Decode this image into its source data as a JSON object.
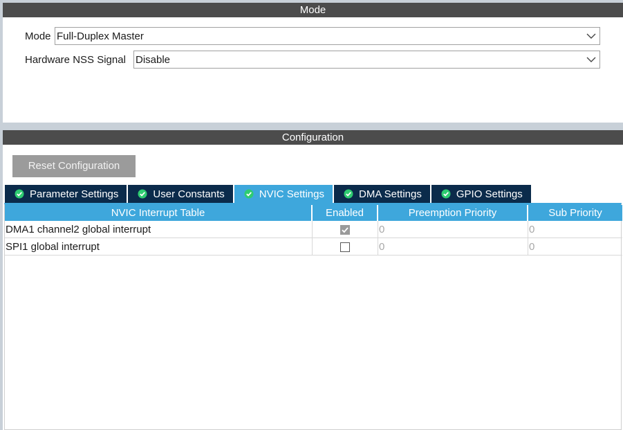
{
  "mode": {
    "header": "Mode",
    "fields": [
      {
        "label": "Mode",
        "value": "Full-Duplex Master"
      },
      {
        "label": "Hardware NSS Signal",
        "value": "Disable"
      }
    ]
  },
  "configuration": {
    "header": "Configuration",
    "reset_button": "Reset Configuration",
    "tabs": [
      {
        "label": "Parameter Settings",
        "active": false
      },
      {
        "label": "User Constants",
        "active": false
      },
      {
        "label": "NVIC Settings",
        "active": true
      },
      {
        "label": "DMA Settings",
        "active": false
      },
      {
        "label": "GPIO Settings",
        "active": false
      }
    ],
    "nvic_table": {
      "columns": [
        "NVIC Interrupt Table",
        "Enabled",
        "Preemption Priority",
        "Sub Priority"
      ],
      "rows": [
        {
          "name": "DMA1 channel2 global interrupt",
          "enabled": true,
          "preemption": "0",
          "sub": "0"
        },
        {
          "name": "SPI1 global interrupt",
          "enabled": false,
          "preemption": "0",
          "sub": "0"
        }
      ]
    }
  },
  "icons": {
    "select_arrow": "chevron-down-icon",
    "tab_status": "check-circle-icon",
    "checkbox_tick": "checkmark-icon"
  },
  "colors": {
    "section_header_bg": "#4c4c4c",
    "tab_bg": "#0b2b4b",
    "tab_active_bg": "#3ea7dc",
    "tab_check": "#2ecc71",
    "table_header_bg": "#3ea7dc",
    "button_bg": "#9b9b9b"
  }
}
